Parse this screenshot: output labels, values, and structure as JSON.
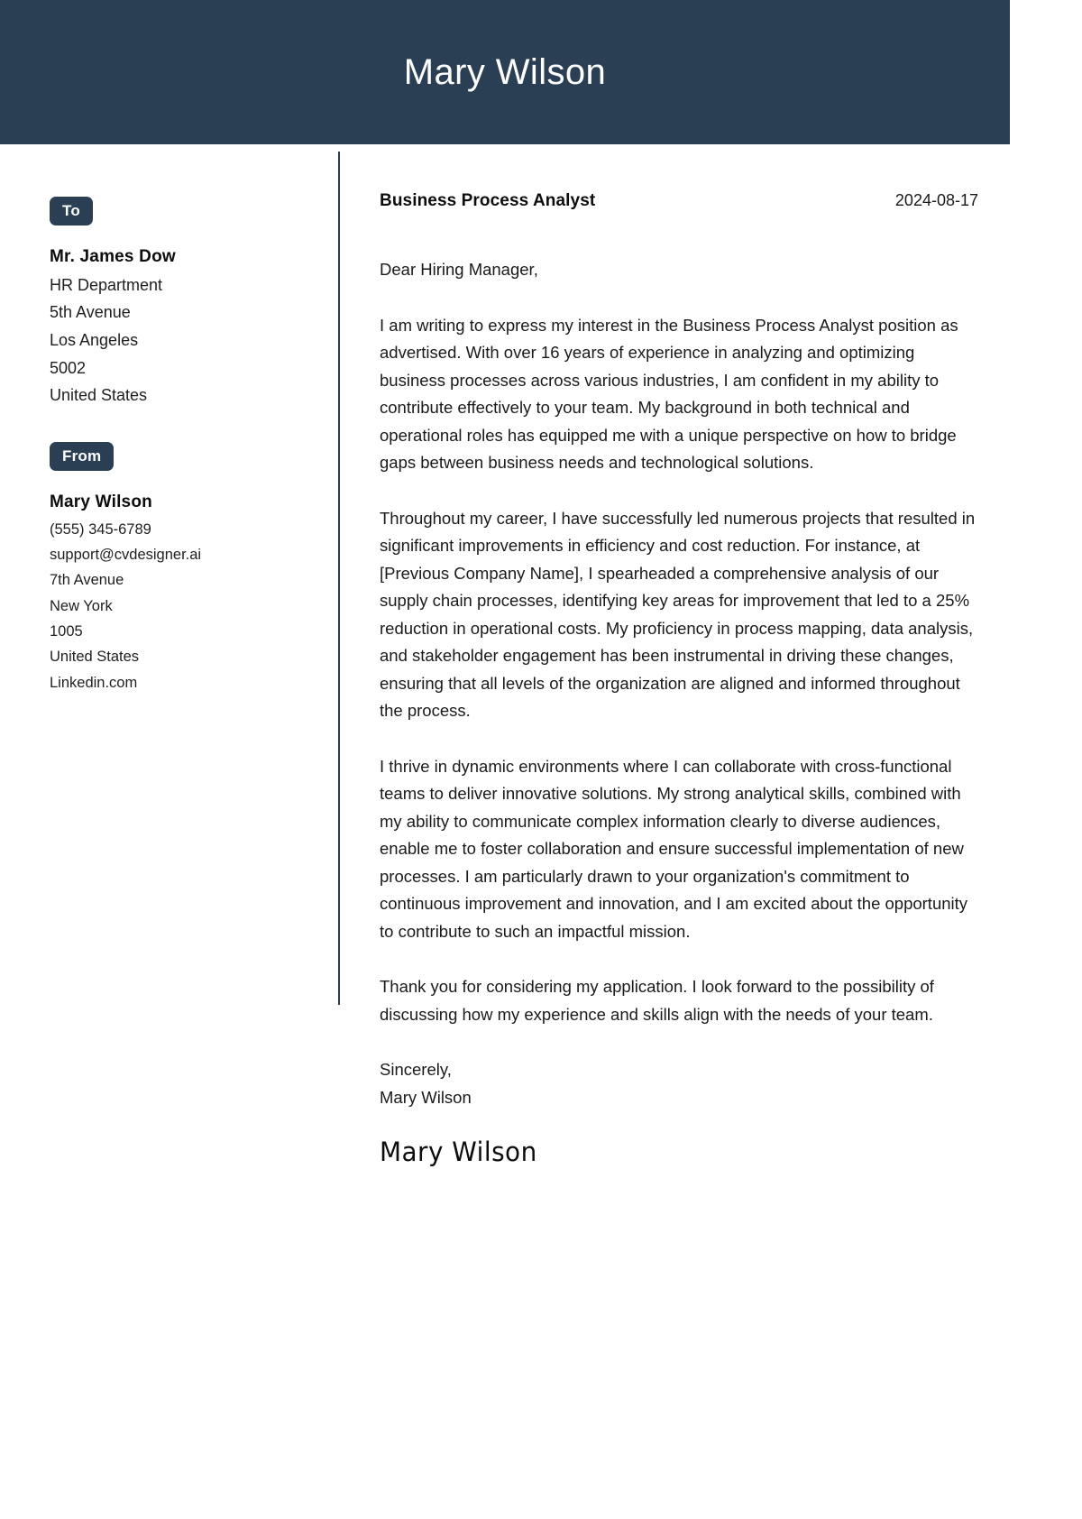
{
  "header": {
    "name": "Mary Wilson"
  },
  "sidebar": {
    "to": {
      "badge_label": "To",
      "name": "Mr. James Dow",
      "lines": [
        "HR Department",
        "5th Avenue",
        "Los Angeles",
        "5002",
        "United States"
      ]
    },
    "from": {
      "badge_label": "From",
      "name": "Mary Wilson",
      "lines": [
        "(555) 345-6789",
        "support@cvdesigner.ai",
        "7th Avenue",
        "New York",
        "1005",
        "United States",
        "Linkedin.com"
      ]
    }
  },
  "letter": {
    "job_title": "Business Process Analyst",
    "date": "2024-08-17",
    "salutation": "Dear Hiring Manager,",
    "paragraphs": [
      "I am writing to express my interest in the Business Process Analyst position as advertised. With over 16 years of experience in analyzing and optimizing business processes across various industries, I am confident in my ability to contribute effectively to your team. My background in both technical and operational roles has equipped me with a unique perspective on how to bridge gaps between business needs and technological solutions.",
      "Throughout my career, I have successfully led numerous projects that resulted in significant improvements in efficiency and cost reduction. For instance, at [Previous Company Name], I spearheaded a comprehensive analysis of our supply chain processes, identifying key areas for improvement that led to a 25% reduction in operational costs. My proficiency in process mapping, data analysis, and stakeholder engagement has been instrumental in driving these changes, ensuring that all levels of the organization are aligned and informed throughout the process.",
      "I thrive in dynamic environments where I can collaborate with cross-functional teams to deliver innovative solutions. My strong analytical skills, combined with my ability to communicate complex information clearly to diverse audiences, enable me to foster collaboration and ensure successful implementation of new processes. I am particularly drawn to your organization's commitment to continuous improvement and innovation, and I am excited about the opportunity to contribute to such an impactful mission.",
      "Thank you for considering my application. I look forward to the possibility of discussing how my experience and skills align with the needs of your team."
    ],
    "closing_word": "Sincerely,",
    "closing_name": "Mary Wilson",
    "signature": "Mary Wilson"
  },
  "colors": {
    "brand_navy": "#2a3f54",
    "text": "#1a1a1a",
    "page_background": "#ffffff"
  }
}
